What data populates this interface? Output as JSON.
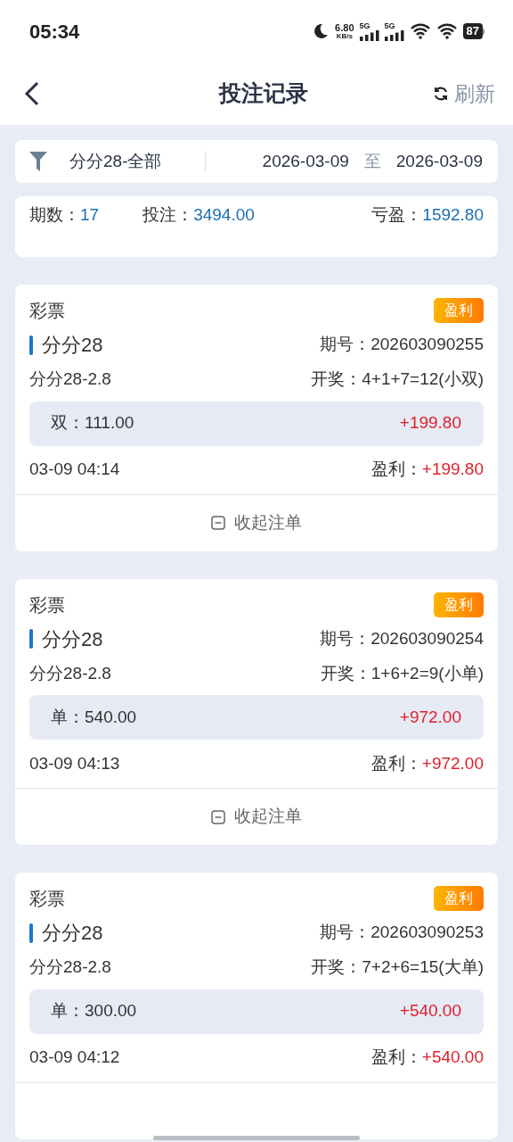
{
  "status_bar": {
    "time": "05:34",
    "net_speed": "6.80",
    "net_unit": "KB/s",
    "signal_1": "5G",
    "signal_2": "5G",
    "battery": "87"
  },
  "header": {
    "title": "投注记录",
    "refresh": "刷新"
  },
  "filter": {
    "game": "分分28-全部",
    "start_date": "2026-03-09",
    "separator": "至",
    "end_date": "2026-03-09"
  },
  "summary": [
    {
      "label": "期数：",
      "value": "17"
    },
    {
      "label": "投注：",
      "value": "3494.00"
    },
    {
      "label": "亏盈：",
      "value": "1592.80"
    }
  ],
  "records": [
    {
      "category": "彩票",
      "badge": "盈利",
      "game": "分分28",
      "issue_label": "期号：",
      "issue": "202603090255",
      "play": "分分28-2.8",
      "draw_label": "开奖：",
      "draw": "4+1+7=12(小双)",
      "bet": "双：111.00",
      "bet_result": "+199.80",
      "time": "03-09 04:14",
      "profit_label": "盈利：",
      "profit": "+199.80",
      "collapse": "收起注单"
    },
    {
      "category": "彩票",
      "badge": "盈利",
      "game": "分分28",
      "issue_label": "期号：",
      "issue": "202603090254",
      "play": "分分28-2.8",
      "draw_label": "开奖：",
      "draw": "1+6+2=9(小单)",
      "bet": "单：540.00",
      "bet_result": "+972.00",
      "time": "03-09 04:13",
      "profit_label": "盈利：",
      "profit": "+972.00",
      "collapse": "收起注单"
    },
    {
      "category": "彩票",
      "badge": "盈利",
      "game": "分分28",
      "issue_label": "期号：",
      "issue": "202603090253",
      "play": "分分28-2.8",
      "draw_label": "开奖：",
      "draw": "7+2+6=15(大单)",
      "bet": "单：300.00",
      "bet_result": "+540.00",
      "time": "03-09 04:12",
      "profit_label": "盈利：",
      "profit": "+540.00"
    }
  ]
}
